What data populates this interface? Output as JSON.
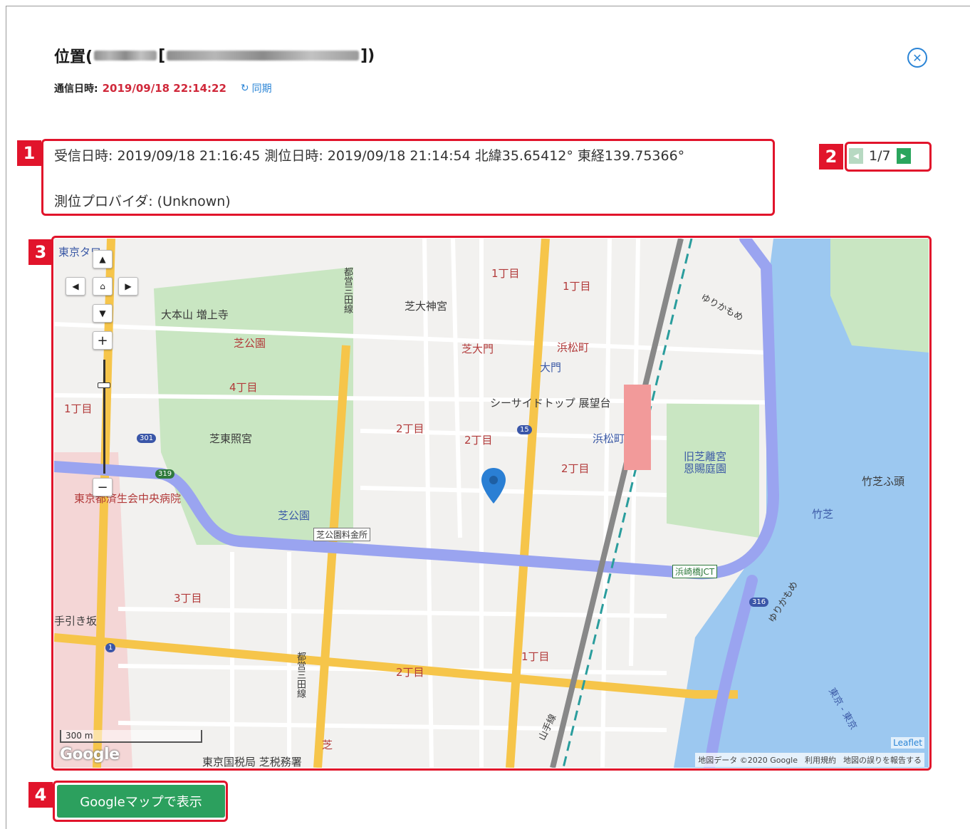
{
  "header": {
    "title_prefix": "位置(",
    "title_mid": " [",
    "title_suffix": "])",
    "close_icon": "close-circle-icon"
  },
  "comm": {
    "label": "通信日時:",
    "time": "2019/09/18 22:14:22",
    "sync_icon": "↻",
    "sync_label": "同期"
  },
  "badges": {
    "b1": "1",
    "b2": "2",
    "b3": "3",
    "b4": "4"
  },
  "info": {
    "line1": "受信日時: 2019/09/18 21:16:45  測位日時: 2019/09/18 21:14:54  北緯35.65412°  東経139.75366°",
    "line2": "測位プロバイダ: (Unknown)"
  },
  "pager": {
    "prev": "◀",
    "label": "1/7",
    "next": "▶"
  },
  "map": {
    "labels": {
      "tokyo_tower": "東京タワー",
      "zojoji": "大本山 増上寺",
      "shiba_park": "芝公園",
      "chome4": "4丁目",
      "chome1a": "1丁目",
      "toshiba_toei": "芝東照宮",
      "saiseikai": "東京都済生会中央病院",
      "shibakoen_st": "芝公園",
      "toll": "芝公園料金所",
      "chome3": "3丁目",
      "tebikizaka": "手引き坂",
      "mita_line_top": "都営三田線",
      "mita_line_bottom": "都営三田線",
      "shiba_daijingu": "芝大神宮",
      "shiba_daimon": "芝大門",
      "daimon": "大門",
      "hamamatsucho_top": "浜松町",
      "chome1b": "1丁目",
      "chome1c": "1丁目",
      "seaside": "シーサイドトップ 展望台",
      "chome2a": "2丁目",
      "chome2b": "2丁目",
      "chome2c": "2丁目",
      "hamamatsucho_st": "浜松町",
      "kyu_shiba": "旧芝離宮\n恩賜庭園",
      "takeshiba_futo": "竹芝ふ頭",
      "takeshiba": "竹芝",
      "yurikamome_top": "ゆりかもめ",
      "yurikamome_bottom": "ゆりかもめ",
      "hamazakibashi": "浜崎橋JCT",
      "chome1d": "1丁目",
      "chome2d": "2丁目",
      "shiba": "芝",
      "tax_office": "東京国税局 芝税務署",
      "yamanote": "山手線",
      "tokyo_bay": "東京 - 東京"
    },
    "route_nums": [
      "301",
      "319",
      "15",
      "316",
      "1"
    ],
    "scale": "300 m",
    "google_logo": "Google",
    "leaflet": "Leaflet",
    "attrib_data": "地図データ ©2020 Google",
    "attrib_terms": "利用規約",
    "attrib_report": "地図の誤りを報告する"
  },
  "button": {
    "open_google_maps": "Googleマップで表示"
  },
  "colors": {
    "accent_red": "#e1142b",
    "time_red": "#d0283a",
    "link_blue": "#2a84d6",
    "button_green": "#2ca05e",
    "expressway": "#9aa4f0",
    "arterial": "#f6c54a",
    "park": "#c9e6c2",
    "water": "#9cc8f0"
  }
}
